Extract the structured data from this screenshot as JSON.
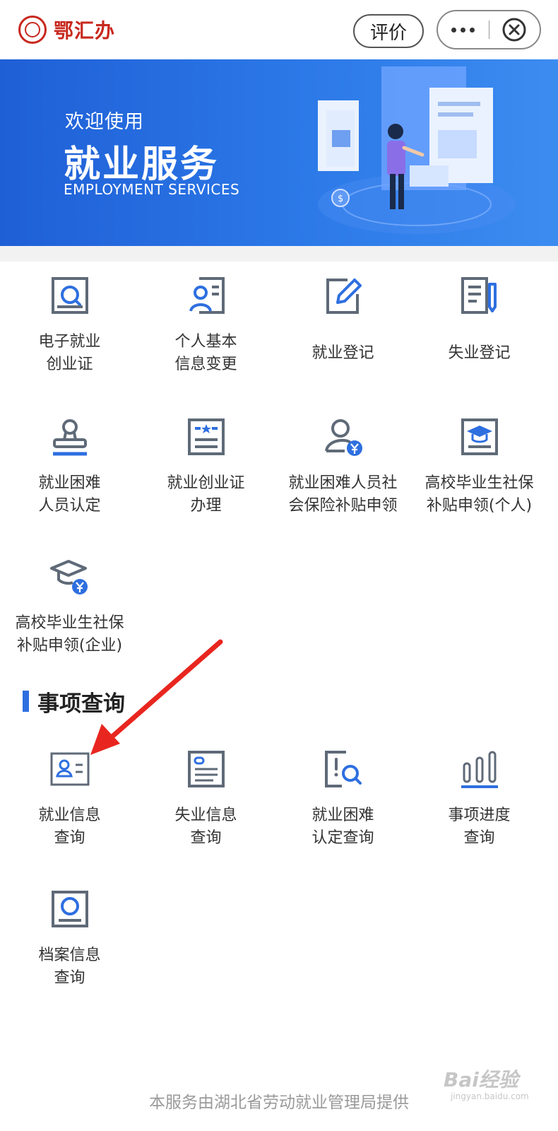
{
  "header": {
    "brand_name": "鄂汇办",
    "rate_label": "评价",
    "more_icon": "more-dots-icon",
    "close_icon": "close-circle-icon"
  },
  "banner": {
    "welcome": "欢迎使用",
    "title": "就业服务",
    "subtitle": "EMPLOYMENT SERVICES"
  },
  "services": [
    {
      "label": "电子就业\n创业证",
      "icon": "search-card-icon"
    },
    {
      "label": "个人基本\n信息变更",
      "icon": "person-card-icon"
    },
    {
      "label": "就业登记",
      "icon": "edit-icon"
    },
    {
      "label": "失业登记",
      "icon": "document-pen-icon"
    },
    {
      "label": "就业困难\n人员认定",
      "icon": "stamp-icon"
    },
    {
      "label": "就业创业证\n办理",
      "icon": "certificate-icon"
    },
    {
      "label": "就业困难人员社\n会保险补贴申领",
      "icon": "person-yuan-icon"
    },
    {
      "label": "高校毕业生社保\n补贴申领(个人)",
      "icon": "graduation-card-icon"
    },
    {
      "label": "高校毕业生社保\n补贴申领(企业)",
      "icon": "graduation-yuan-icon"
    }
  ],
  "query_section": {
    "title": "事项查询",
    "items": [
      {
        "label": "就业信息\n查询",
        "icon": "id-card-icon"
      },
      {
        "label": "失业信息\n查询",
        "icon": "profile-card-icon"
      },
      {
        "label": "就业困难\n认定查询",
        "icon": "alert-search-icon"
      },
      {
        "label": "事项进度\n查询",
        "icon": "bar-chart-icon"
      },
      {
        "label": "档案信息\n查询",
        "icon": "archive-search-icon"
      }
    ]
  },
  "footer": {
    "text": "本服务由湖北省劳动就业管理局提供"
  },
  "watermark": {
    "text": "Bai经验",
    "sub": "jingyan.baidu.com"
  },
  "colors": {
    "accent": "#2e6fe0",
    "icon_gray": "#5f6a78",
    "brand_red": "#c8281e",
    "arrow_red": "#e8261f"
  }
}
